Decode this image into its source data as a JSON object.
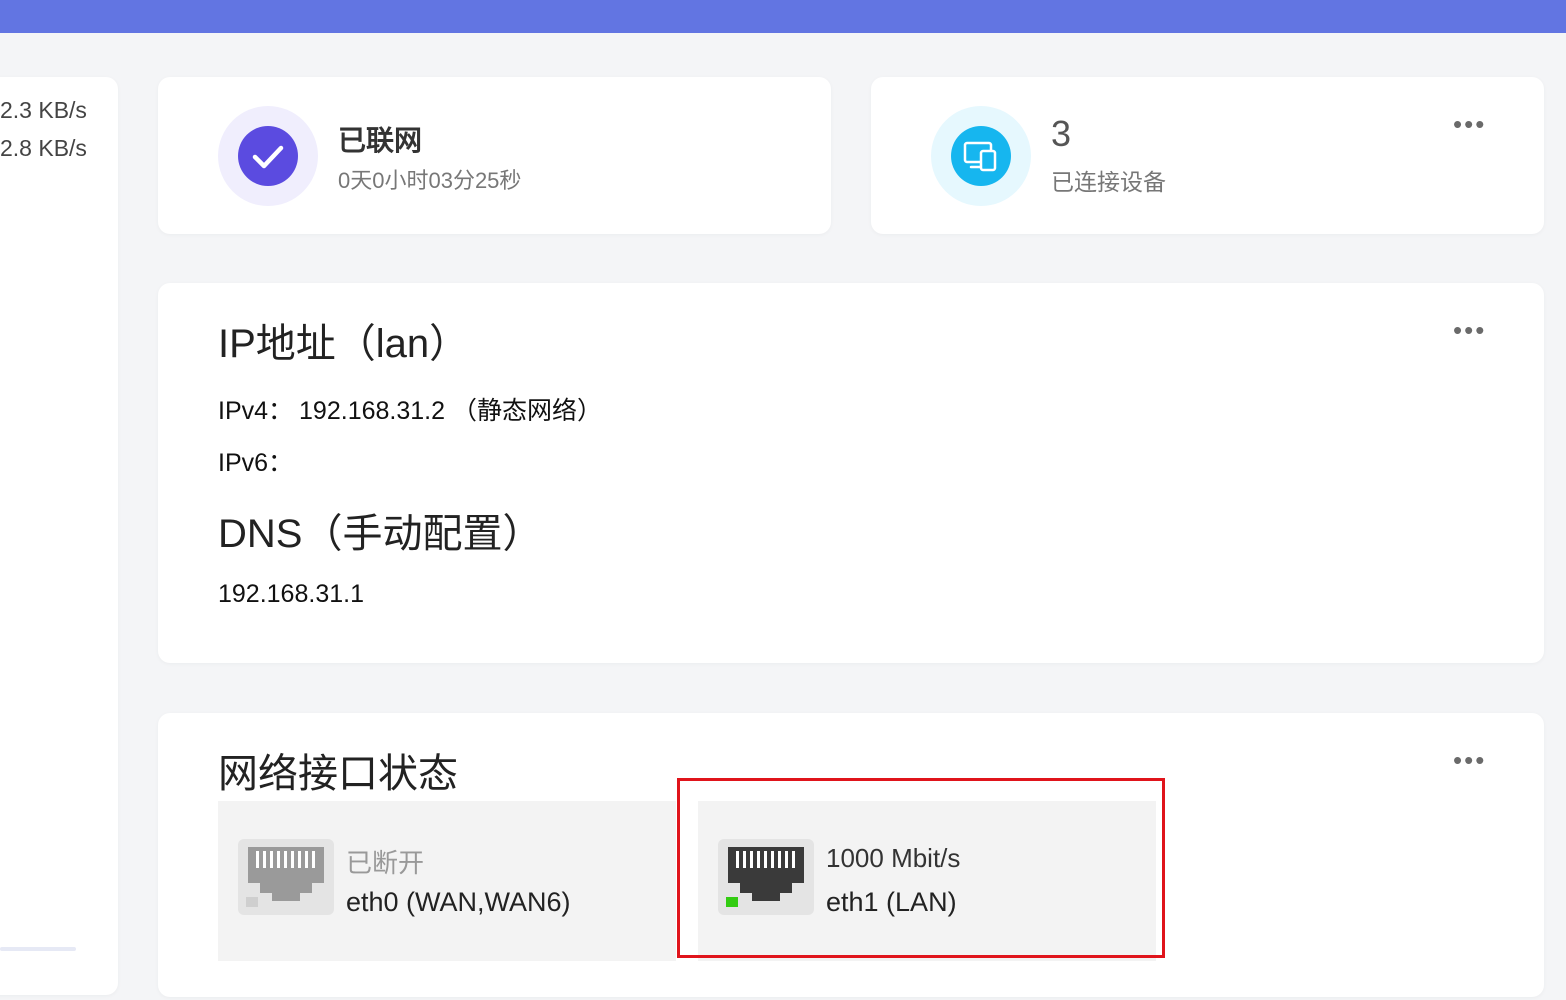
{
  "speeds": {
    "upload": "2.3 KB/s",
    "download": "2.8 KB/s"
  },
  "status_card": {
    "title": "已联网",
    "uptime": "0天0小时03分25秒"
  },
  "devices_card": {
    "count": "3",
    "label": "已连接设备",
    "menu": "•••"
  },
  "ip_card": {
    "title": "IP地址（lan）",
    "ipv4_label": "IPv4：",
    "ipv4_value": "192.168.31.2 （静态网络）",
    "ipv6_label": "IPv6：",
    "dns_title": "DNS（手动配置）",
    "dns_value": "192.168.31.1",
    "menu": "•••"
  },
  "interfaces_card": {
    "title": "网络接口状态",
    "menu": "•••",
    "ports": [
      {
        "status": "已断开",
        "name": "eth0 (WAN,WAN6)",
        "connected": false
      },
      {
        "status": "1000 Mbit/s",
        "name": "eth1 (LAN)",
        "connected": true
      }
    ]
  },
  "colors": {
    "topbar": "#6275e2",
    "check_circle": "#5b4be0",
    "device_circle": "#16b6ef",
    "link_led": "#33cc12",
    "highlight": "#e0141b"
  }
}
